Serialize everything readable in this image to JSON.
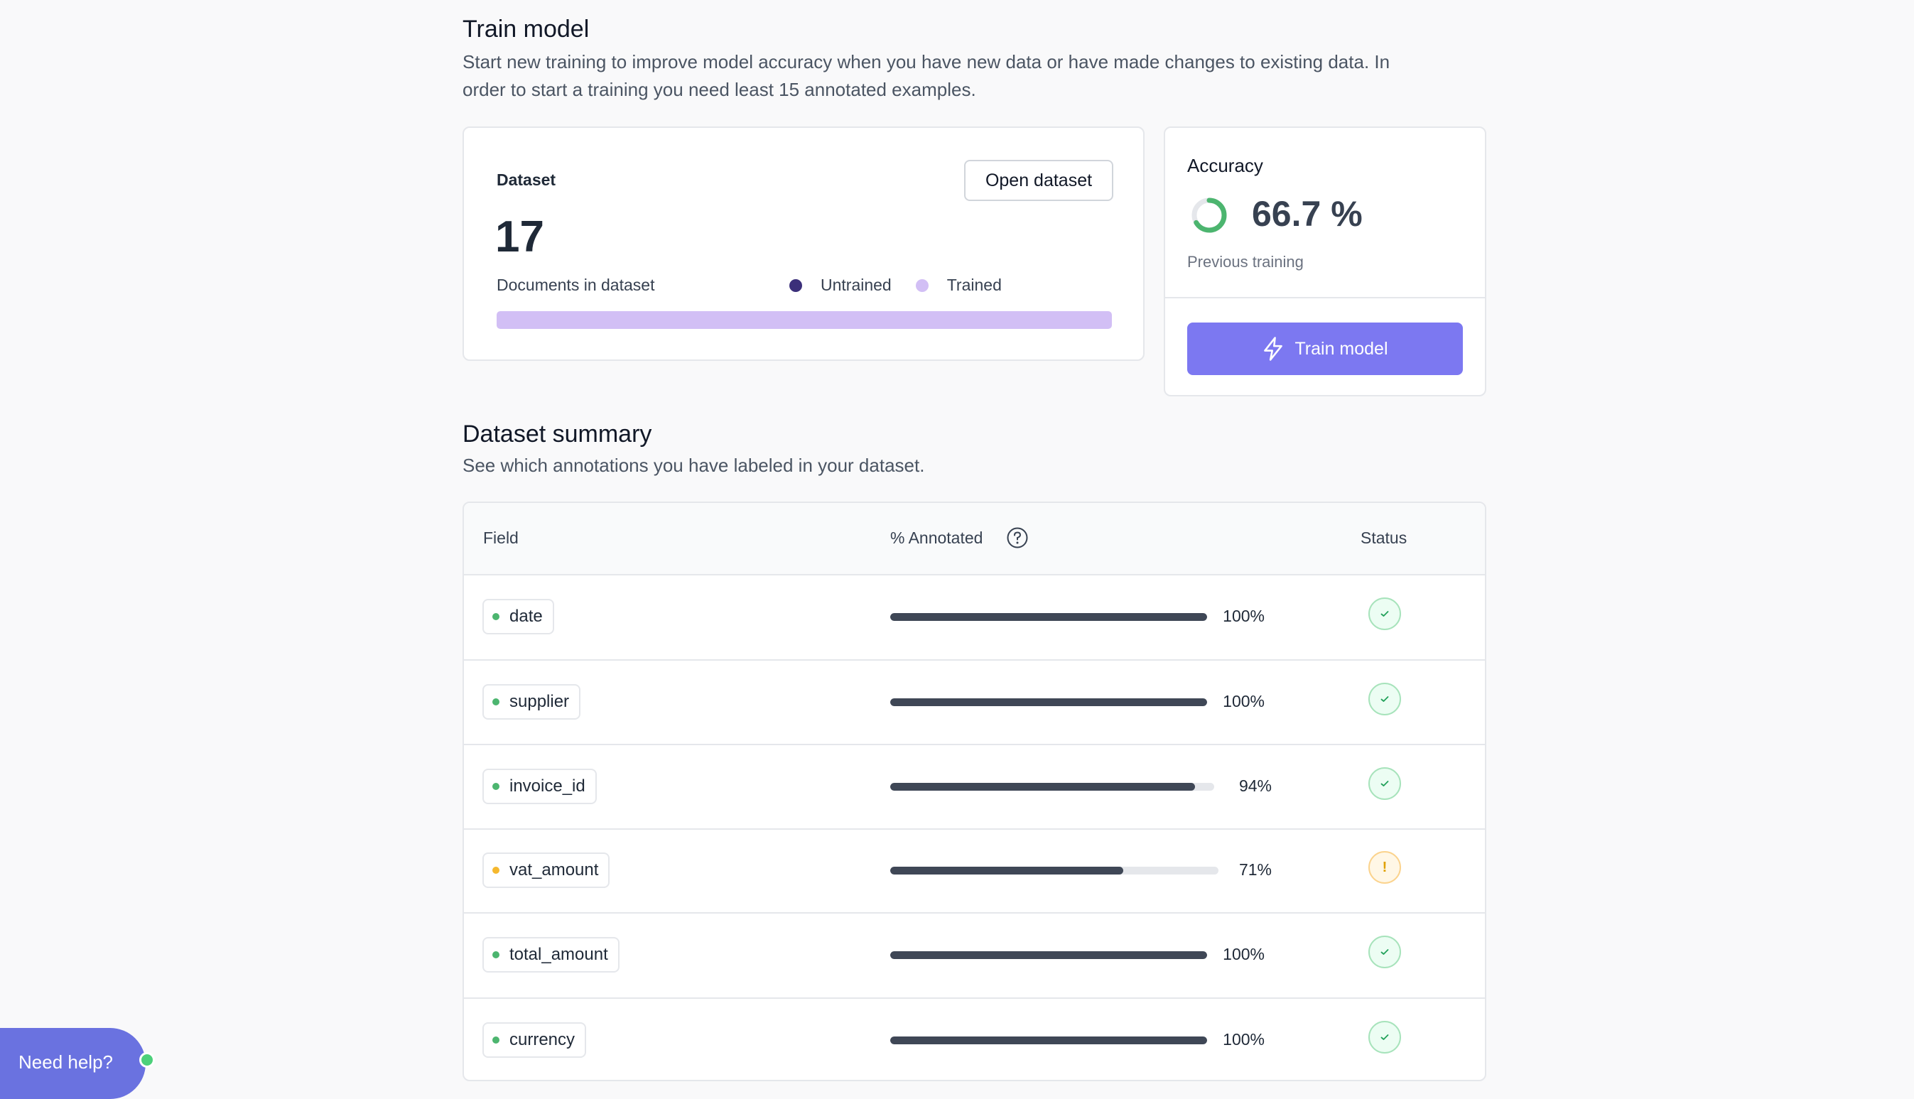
{
  "train": {
    "title": "Train model",
    "description_line1": "Start new training to improve model accuracy when you have new data or have made changes to existing data. In",
    "description_line2": "order to start a training you need least 15 annotated examples."
  },
  "dataset_card": {
    "label": "Dataset",
    "open_button": "Open dataset",
    "count": "17",
    "count_label": "Documents in dataset",
    "legend": [
      {
        "label": "Untrained",
        "color": "#3b2f7a"
      },
      {
        "label": "Trained",
        "color": "#d2bff5"
      }
    ],
    "trained_fraction": 1.0
  },
  "accuracy_card": {
    "label": "Accuracy",
    "value": "66.7 %",
    "value_fraction": 0.667,
    "sublabel": "Previous training",
    "train_button": "Train model",
    "ring_color": "#4cb56f",
    "icon": "lightning-icon"
  },
  "summary": {
    "title": "Dataset summary",
    "description": "See which annotations you have labeled in your dataset.",
    "columns": {
      "field": "Field",
      "annotated": "% Annotated",
      "status": "Status"
    },
    "rows": [
      {
        "field": "date",
        "percent": "100%",
        "value": 1.0,
        "status": "ok"
      },
      {
        "field": "supplier",
        "percent": "100%",
        "value": 1.0,
        "status": "ok"
      },
      {
        "field": "invoice_id",
        "percent": "94%",
        "value": 0.94,
        "status": "ok"
      },
      {
        "field": "vat_amount",
        "percent": "71%",
        "value": 0.71,
        "status": "warn"
      },
      {
        "field": "total_amount",
        "percent": "100%",
        "value": 1.0,
        "status": "ok"
      },
      {
        "field": "currency",
        "percent": "100%",
        "value": 1.0,
        "status": "ok"
      }
    ]
  },
  "help": {
    "label": "Need help?"
  }
}
